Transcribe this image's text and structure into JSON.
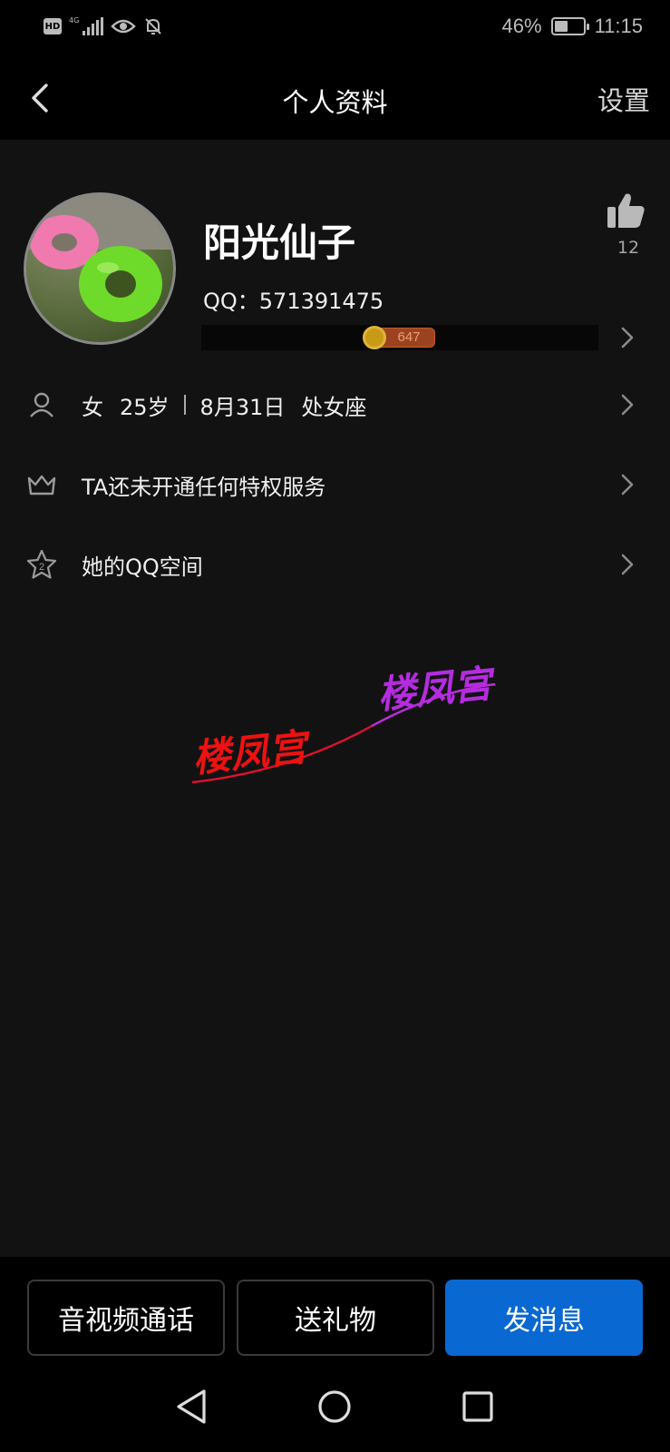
{
  "status_bar": {
    "left_icons": [
      "hd-icon",
      "signal-4g-icon",
      "eye-icon",
      "bell-mute-icon"
    ],
    "signal_label": "4G",
    "hd_label": "HD",
    "battery_percent": "46%",
    "battery_level": 0.46,
    "time": "11:15"
  },
  "header": {
    "title": "个人资料",
    "settings_label": "设置"
  },
  "profile": {
    "nickname": "阳光仙子",
    "qq": "QQ：571391475",
    "like_count": "12",
    "coin_value": "647"
  },
  "info_rows": {
    "basic": {
      "gender": "女",
      "age": "25岁",
      "birthday": "8月31日",
      "zodiac": "处女座"
    },
    "privilege": "TA还未开通任何特权服务",
    "qzone": "她的QQ空间"
  },
  "watermark": {
    "text_red": "楼凤宫",
    "text_purple": "楼凤宫",
    "colors": [
      "#ee1111",
      "#b52ce0"
    ]
  },
  "actions": {
    "call": "音视频通话",
    "gift": "送礼物",
    "message": "发消息"
  },
  "colors": {
    "primary": "#0a68d2",
    "background": "#121212"
  }
}
